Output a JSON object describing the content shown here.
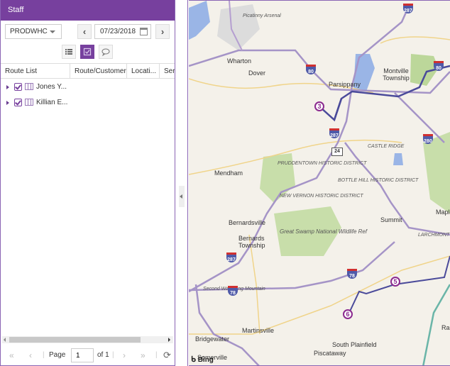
{
  "panel": {
    "title": "Staff",
    "depot_select": "PRODWHC",
    "prev_label": "‹",
    "next_label": "›",
    "date": "07/23/2018",
    "view_buttons": [
      "list-view",
      "checklist-view",
      "comment-view"
    ],
    "active_view": "checklist-view",
    "columns": [
      "Route List",
      "Route/Customer",
      "Locati...",
      "Ser"
    ],
    "routes": [
      {
        "name": "Jones Y...",
        "checked": true
      },
      {
        "name": "Killian E...",
        "checked": true
      }
    ],
    "pager": {
      "first": "«",
      "prev": "‹",
      "page_label": "Page",
      "page_value": "1",
      "of_label": "of 1",
      "next": "›",
      "last": "»",
      "refresh": "⟳"
    }
  },
  "map": {
    "attribution": "Bing",
    "places": [
      {
        "name": "Picatinny Arsenal",
        "italic": true
      },
      {
        "name": "Wharton"
      },
      {
        "name": "Dover"
      },
      {
        "name": "Parsippany"
      },
      {
        "name": "Montville Township"
      },
      {
        "name": "Mendham"
      },
      {
        "name": "Bernardsville"
      },
      {
        "name": "Bernards Township"
      },
      {
        "name": "Summit"
      },
      {
        "name": "Maple"
      },
      {
        "name": "Martinsville"
      },
      {
        "name": "Bridgewater"
      },
      {
        "name": "Somerville"
      },
      {
        "name": "South Plainfield"
      },
      {
        "name": "Piscataway"
      },
      {
        "name": "Ra"
      },
      {
        "name": "PRUDDENTOWN HISTORIC DISTRICT",
        "italic": true
      },
      {
        "name": "NEW VERNON HISTORIC DISTRICT",
        "italic": true
      },
      {
        "name": "BOTTLE HILL HISTORIC DISTRICT",
        "italic": true
      },
      {
        "name": "CASTLE RIDGE",
        "italic": true
      },
      {
        "name": "LARCHMONT ESTATES",
        "italic": true
      },
      {
        "name": "Great Swamp National Wildlife Ref",
        "italic": true
      },
      {
        "name": "Second Watchung Mountain",
        "italic": true
      }
    ],
    "shields": [
      "287",
      "80",
      "80",
      "287",
      "280",
      "24",
      "287",
      "78",
      "78"
    ],
    "stops": [
      "3",
      "5",
      "6"
    ],
    "route_color": "#4a4a9a",
    "stop_color": "#8b2a8f"
  }
}
